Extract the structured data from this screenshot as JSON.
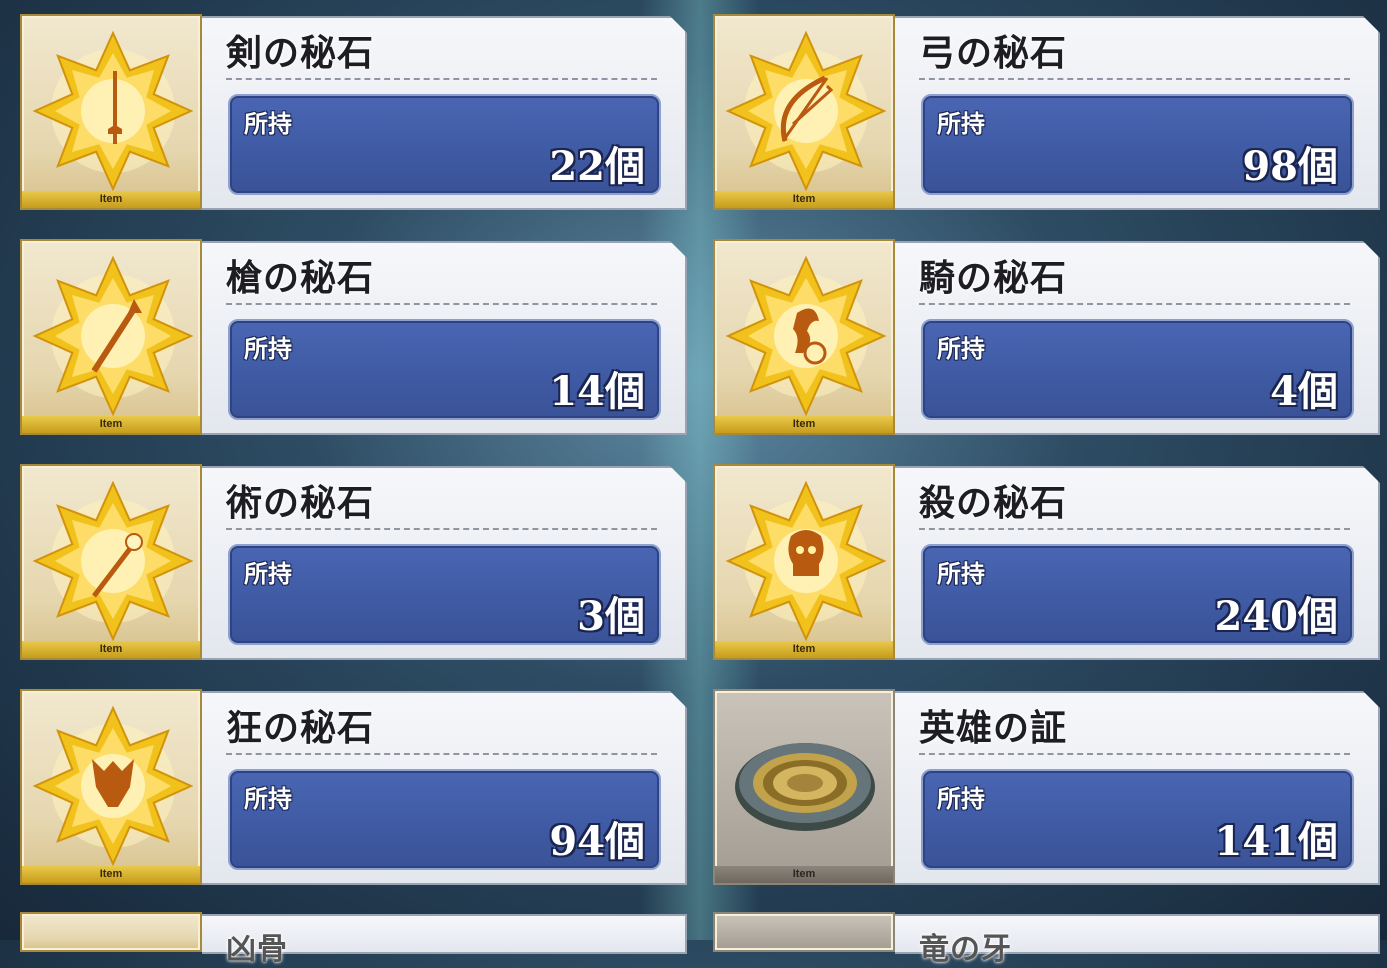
{
  "items": [
    {
      "name": "剣の秘石",
      "owned_label": "所持",
      "count": "22個",
      "thumb_label": "Item",
      "icon": "saber-gem-icon",
      "style": "gold",
      "glyph": "sword"
    },
    {
      "name": "弓の秘石",
      "owned_label": "所持",
      "count": "98個",
      "thumb_label": "Item",
      "icon": "archer-gem-icon",
      "style": "gold",
      "glyph": "bow"
    },
    {
      "name": "槍の秘石",
      "owned_label": "所持",
      "count": "14個",
      "thumb_label": "Item",
      "icon": "lancer-gem-icon",
      "style": "gold",
      "glyph": "spear"
    },
    {
      "name": "騎の秘石",
      "owned_label": "所持",
      "count": "4個",
      "thumb_label": "Item",
      "icon": "rider-gem-icon",
      "style": "gold",
      "glyph": "rider"
    },
    {
      "name": "術の秘石",
      "owned_label": "所持",
      "count": "3個",
      "thumb_label": "Item",
      "icon": "caster-gem-icon",
      "style": "gold",
      "glyph": "staff"
    },
    {
      "name": "殺の秘石",
      "owned_label": "所持",
      "count": "240個",
      "thumb_label": "Item",
      "icon": "assassin-gem-icon",
      "style": "gold",
      "glyph": "skull"
    },
    {
      "name": "狂の秘石",
      "owned_label": "所持",
      "count": "94個",
      "thumb_label": "Item",
      "icon": "berserker-gem-icon",
      "style": "gold",
      "glyph": "beast"
    },
    {
      "name": "英雄の証",
      "owned_label": "所持",
      "count": "141個",
      "thumb_label": "Item",
      "icon": "heroic-proof-icon",
      "style": "gray",
      "glyph": "medal"
    }
  ],
  "partial_items": [
    {
      "name": "凶骨"
    },
    {
      "name": "竜の牙"
    }
  ],
  "colors": {
    "gem_gold": "#f2c21c",
    "count_box_blue": "#4561ac"
  }
}
